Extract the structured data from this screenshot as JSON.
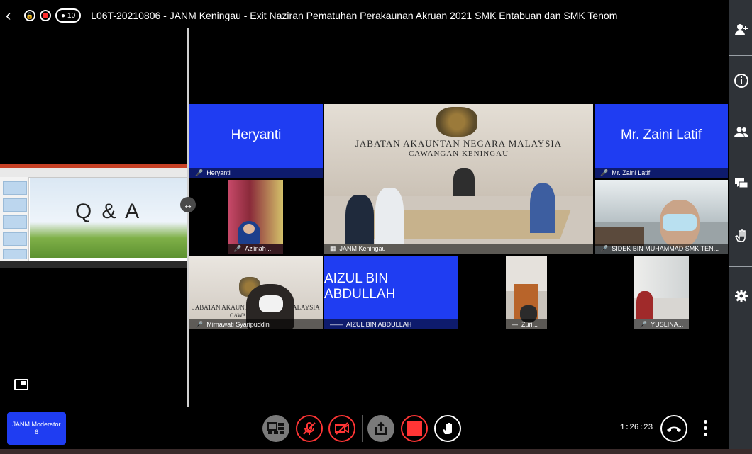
{
  "header": {
    "participant_count": "10",
    "title": "L06T-20210806 - JANM Keningau - Exit Naziran Pematuhan Perakaunan Akruan 2021 SMK Entabuan dan SMK Tenom"
  },
  "screen_share": {
    "slide_text": "Q & A"
  },
  "tiles": [
    {
      "big": "Heryanti",
      "label": "Heryanti"
    },
    {
      "big": "Mr. Zaini Latif",
      "label": "Mr. Zaini Latif"
    },
    {
      "label": "Azlinah ..."
    },
    {
      "label": "JANM Keningau",
      "sign1": "JABATAN AKAUNTAN NEGARA MALAYSIA",
      "sign2": "CAWANGAN KENINGAU"
    },
    {
      "label": "SIDEK BIN MUHAMMAD SMK TEN..."
    },
    {
      "label": "Mirnawati Syaripuddin",
      "sign1": "JABATAN AKAUNTAN NEGARA MALAYSIA",
      "sign2": "CAWANGAN"
    },
    {
      "big": "AIZUL BIN ABDULLAH",
      "label": "AIZUL BIN ABDULLAH"
    },
    {
      "label": "Zuri..."
    },
    {
      "label": "YUSLINA..."
    }
  ],
  "moderator": {
    "name": "JANM Moderator",
    "count": "6"
  },
  "timer": "1:26:23",
  "colors": {
    "tile_blue": "#1f3df2",
    "danger": "#ff3535",
    "sidebar": "#2f3338"
  },
  "icons": [
    "back-icon",
    "lock-icon",
    "record-icon",
    "person-icon",
    "add-person-icon",
    "info-icon",
    "participants-icon",
    "chat-icon",
    "raise-hand-icon",
    "settings-icon",
    "layout-icon",
    "mic-off-icon",
    "video-off-icon",
    "share-screen-icon",
    "stop-record-icon",
    "hand-icon",
    "hang-up-icon",
    "more-icon"
  ]
}
